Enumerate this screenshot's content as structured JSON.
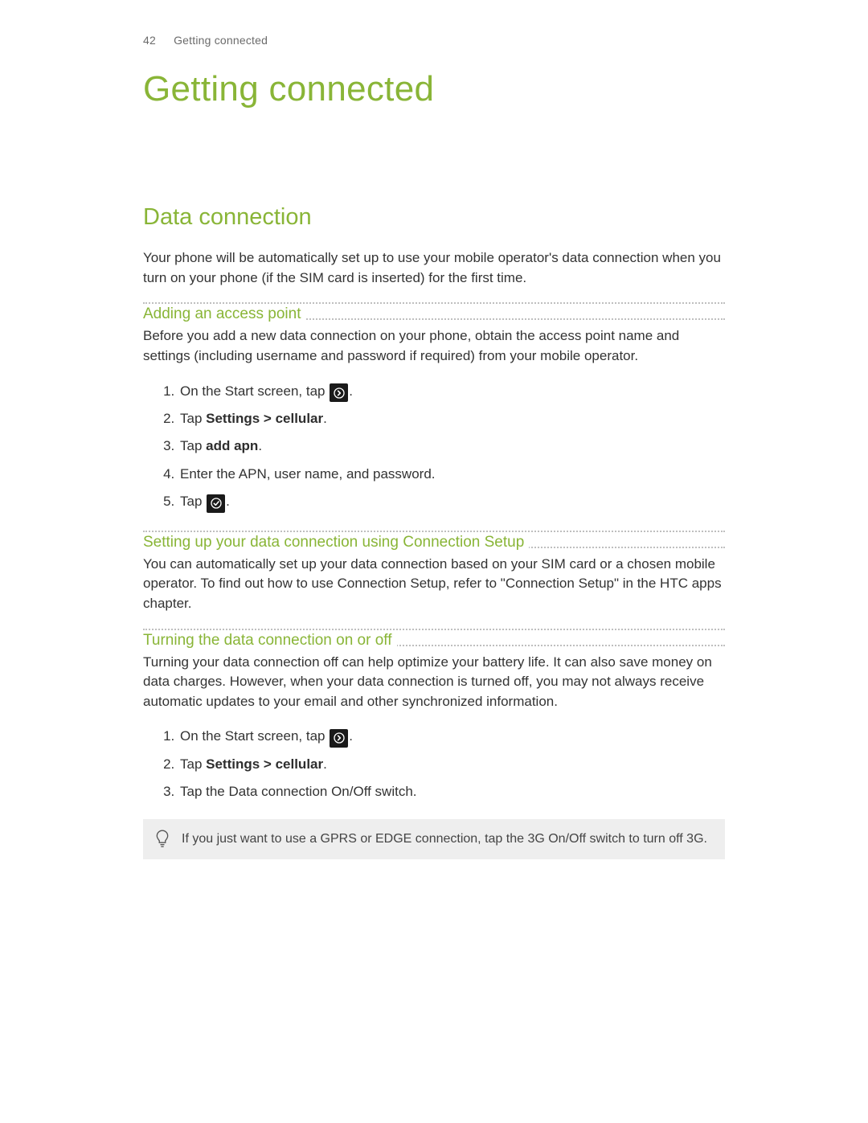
{
  "header": {
    "page_number": "42",
    "running_title": "Getting connected"
  },
  "chapter_title": "Getting connected",
  "section": {
    "title": "Data connection",
    "intro": "Your phone will be automatically set up to use your mobile operator's data connection when you turn on your phone (if the SIM card is inserted) for the first time."
  },
  "sub1": {
    "heading": "Adding an access point",
    "intro": "Before you add a new data connection on your phone, obtain the access point name and settings (including username and password if required) from your mobile operator.",
    "steps": {
      "s1_pre": "On the Start screen, tap ",
      "s1_post": ".",
      "s2_pre": "Tap ",
      "s2_bold": "Settings > cellular",
      "s2_post": ".",
      "s3_pre": "Tap ",
      "s3_bold": "add apn",
      "s3_post": ".",
      "s4": "Enter the APN, user name, and password.",
      "s5_pre": "Tap ",
      "s5_post": "."
    }
  },
  "sub2": {
    "heading": "Setting up your data connection using Connection Setup",
    "body": "You can automatically set up your data connection based on your SIM card or a chosen mobile operator. To find out how to use Connection Setup, refer to \"Connection Setup\" in the HTC apps chapter."
  },
  "sub3": {
    "heading": "Turning the data connection on or off",
    "body": "Turning your data connection off can help optimize your battery life. It can also save money on data charges. However, when your data connection is turned off, you may not always receive automatic updates to your email and other synchronized information.",
    "steps": {
      "s1_pre": "On the Start screen, tap ",
      "s1_post": ".",
      "s2_pre": "Tap ",
      "s2_bold": "Settings > cellular",
      "s2_post": ".",
      "s3": "Tap the Data connection On/Off switch."
    }
  },
  "tip": "If you just want to use a GPRS or EDGE connection, tap the 3G On/Off switch to turn off 3G."
}
